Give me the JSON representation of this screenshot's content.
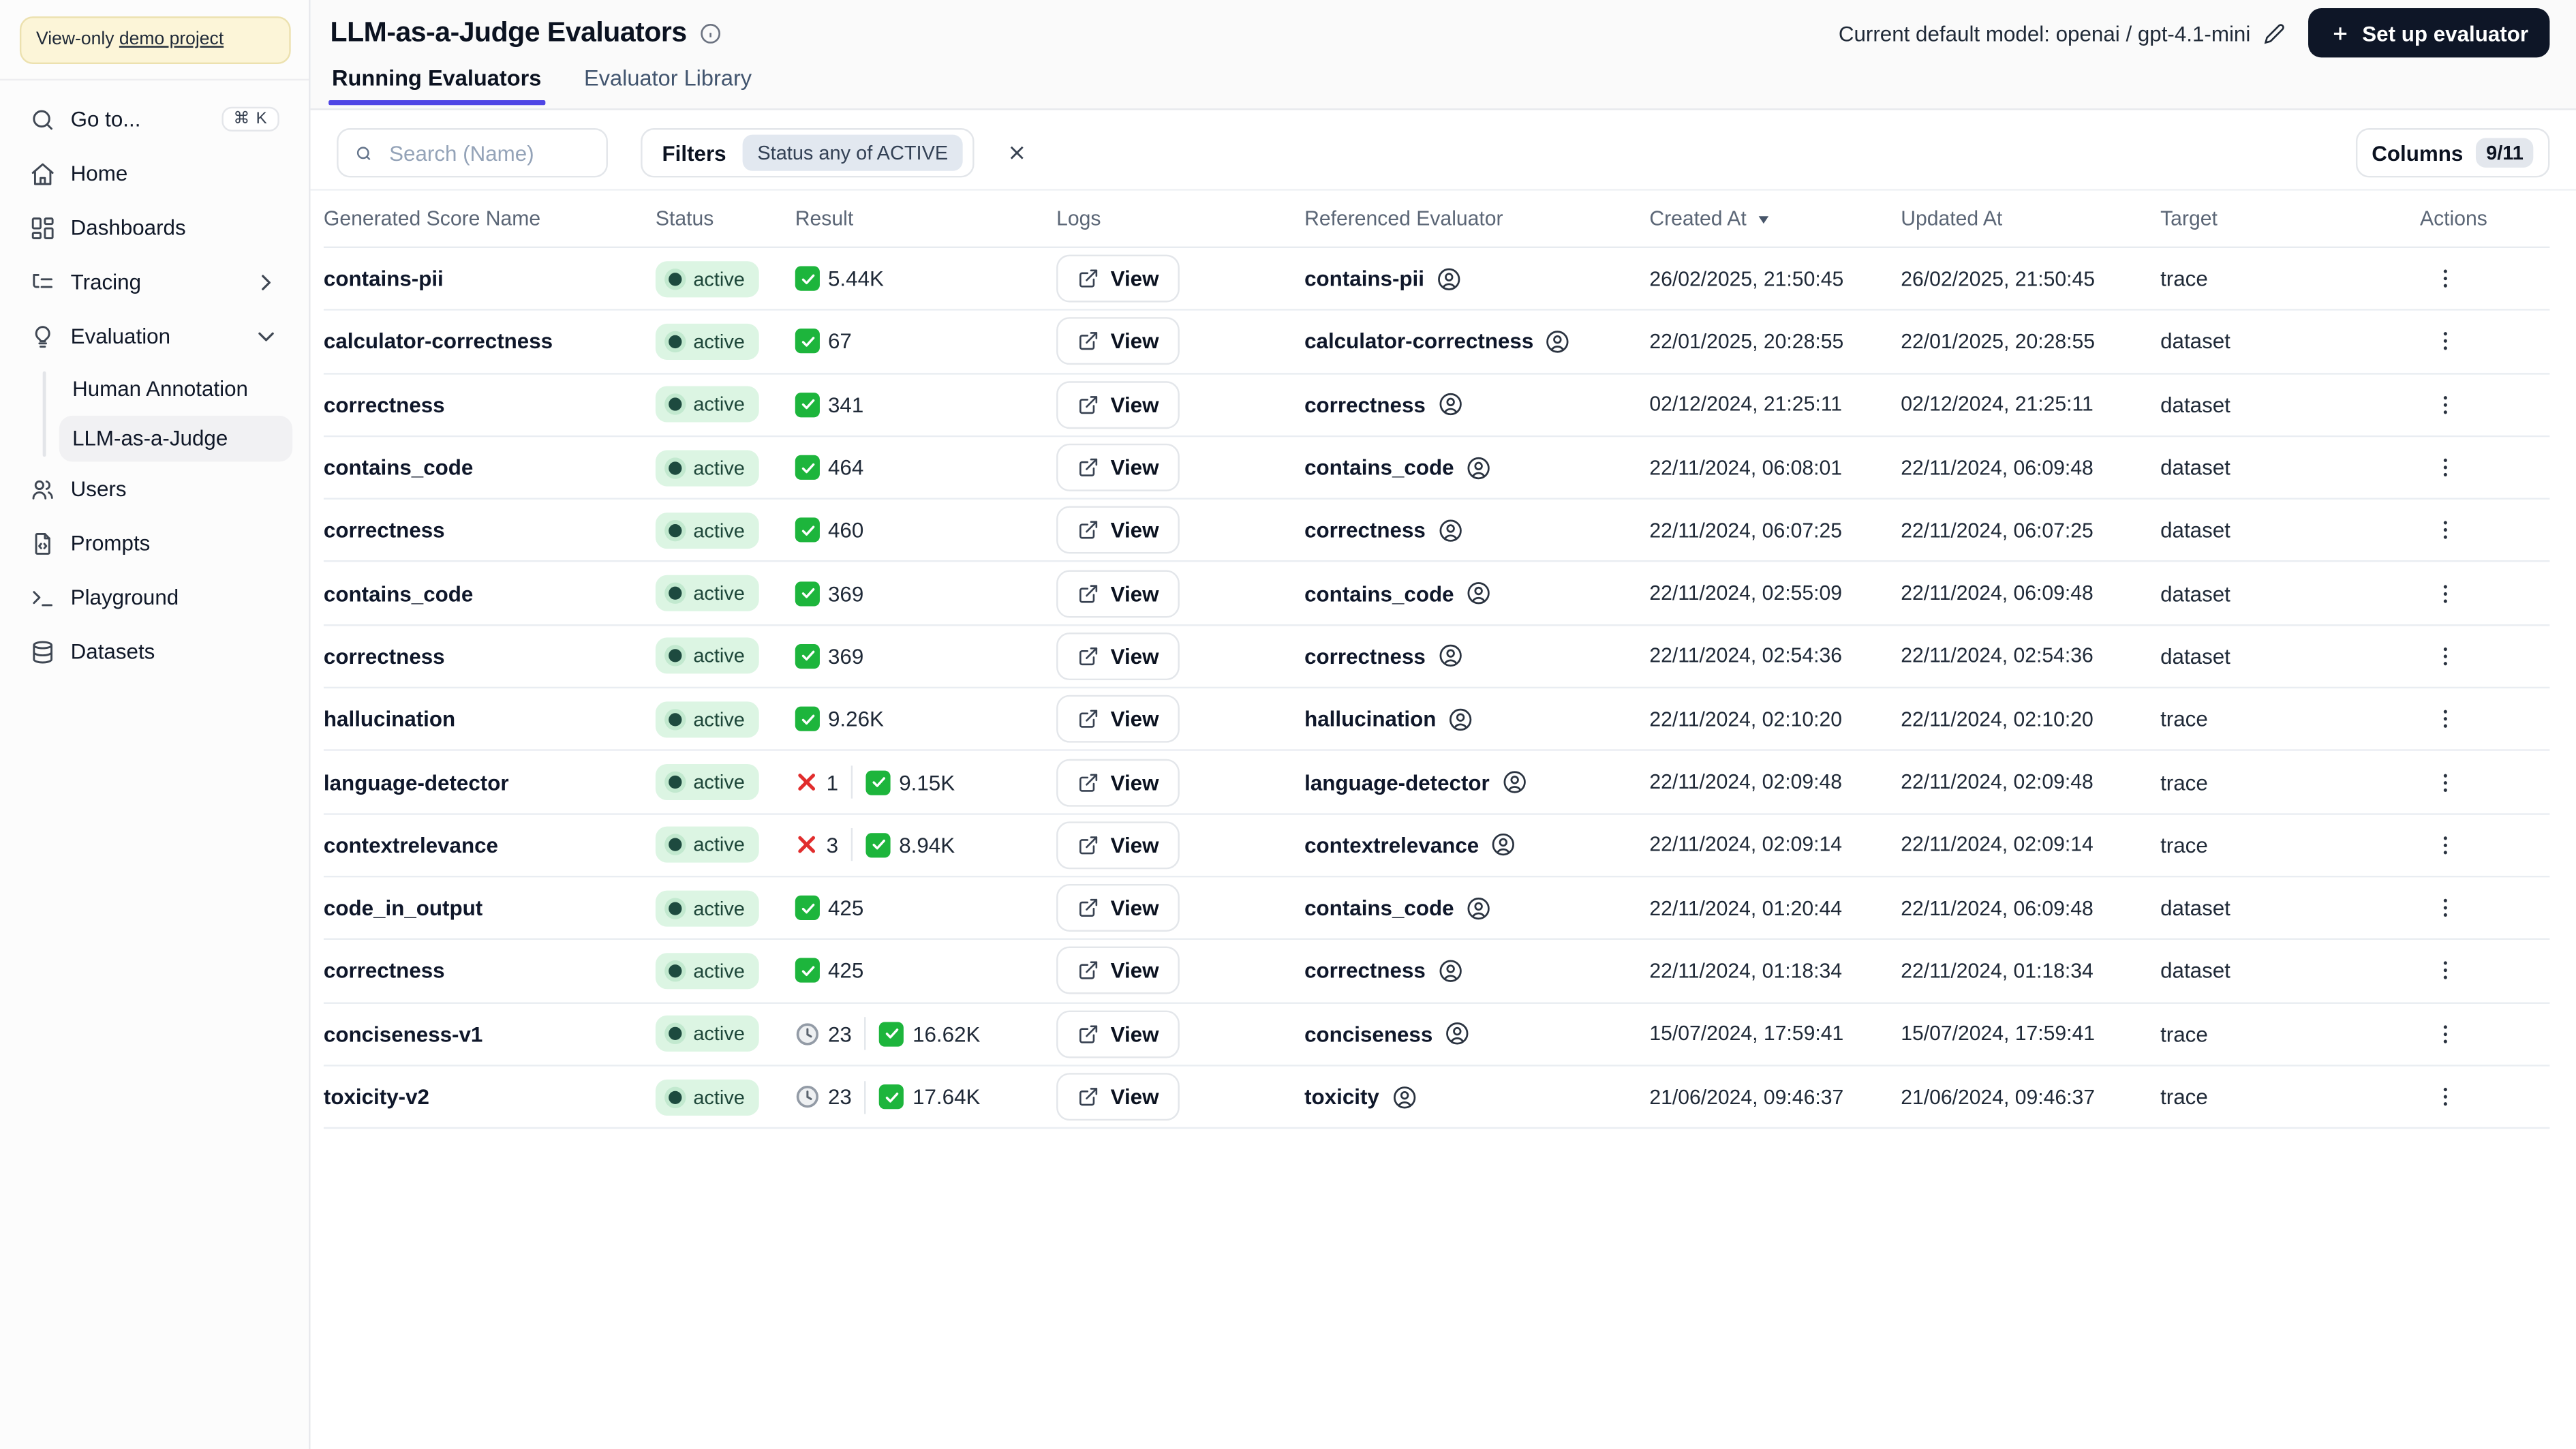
{
  "banner": {
    "prefix": "View-only ",
    "link": "demo project"
  },
  "sidebar": {
    "items": [
      {
        "id": "goto",
        "label": "Go to...",
        "icon": "search",
        "shortcut": "⌘ K"
      },
      {
        "id": "home",
        "label": "Home",
        "icon": "home"
      },
      {
        "id": "dashboards",
        "label": "Dashboards",
        "icon": "dashboard"
      },
      {
        "id": "tracing",
        "label": "Tracing",
        "icon": "tracing",
        "chevron": "right"
      },
      {
        "id": "evaluation",
        "label": "Evaluation",
        "icon": "lightbulb",
        "chevron": "down"
      },
      {
        "id": "human-annotation",
        "label": "Human Annotation",
        "sub": true
      },
      {
        "id": "llm-as-a-judge",
        "label": "LLM-as-a-Judge",
        "sub": true,
        "active": true
      },
      {
        "id": "users",
        "label": "Users",
        "icon": "users"
      },
      {
        "id": "prompts",
        "label": "Prompts",
        "icon": "prompts"
      },
      {
        "id": "playground",
        "label": "Playground",
        "icon": "playground"
      },
      {
        "id": "datasets",
        "label": "Datasets",
        "icon": "datasets"
      }
    ]
  },
  "header": {
    "title": "LLM-as-a-Judge Evaluators",
    "model_label": "Current default model: openai / gpt-4.1-mini",
    "setup_label": "Set up evaluator"
  },
  "tabs": [
    {
      "label": "Running Evaluators",
      "active": true
    },
    {
      "label": "Evaluator Library",
      "active": false
    }
  ],
  "toolbar": {
    "search_placeholder": "Search (Name)",
    "filters_label": "Filters",
    "filter_chip": "Status any of ACTIVE",
    "columns_label": "Columns",
    "columns_badge": "9/11"
  },
  "table": {
    "columns": [
      {
        "label": "Generated Score Name"
      },
      {
        "label": "Status"
      },
      {
        "label": "Result"
      },
      {
        "label": "Logs"
      },
      {
        "label": "Referenced Evaluator"
      },
      {
        "label": "Created At",
        "sort": "desc"
      },
      {
        "label": "Updated At"
      },
      {
        "label": "Target"
      },
      {
        "label": "Actions"
      }
    ],
    "view_label": "View",
    "status_label": "active",
    "rows": [
      {
        "name": "contains-pii",
        "status": "active",
        "result": [
          {
            "icon": "check-icon",
            "count": "5.44K"
          }
        ],
        "referenced": "contains-pii",
        "created_at": "26/02/2025, 21:50:45",
        "updated_at": "26/02/2025, 21:50:45",
        "target": "trace"
      },
      {
        "name": "calculator-correctness",
        "status": "active",
        "result": [
          {
            "icon": "check-icon",
            "count": "67"
          }
        ],
        "referenced": "calculator-correctness",
        "created_at": "22/01/2025, 20:28:55",
        "updated_at": "22/01/2025, 20:28:55",
        "target": "dataset"
      },
      {
        "name": "correctness",
        "status": "active",
        "result": [
          {
            "icon": "check-icon",
            "count": "341"
          }
        ],
        "referenced": "correctness",
        "created_at": "02/12/2024, 21:25:11",
        "updated_at": "02/12/2024, 21:25:11",
        "target": "dataset"
      },
      {
        "name": "contains_code",
        "status": "active",
        "result": [
          {
            "icon": "check-icon",
            "count": "464"
          }
        ],
        "referenced": "contains_code",
        "created_at": "22/11/2024, 06:08:01",
        "updated_at": "22/11/2024, 06:09:48",
        "target": "dataset"
      },
      {
        "name": "correctness",
        "status": "active",
        "result": [
          {
            "icon": "check-icon",
            "count": "460"
          }
        ],
        "referenced": "correctness",
        "created_at": "22/11/2024, 06:07:25",
        "updated_at": "22/11/2024, 06:07:25",
        "target": "dataset"
      },
      {
        "name": "contains_code",
        "status": "active",
        "result": [
          {
            "icon": "check-icon",
            "count": "369"
          }
        ],
        "referenced": "contains_code",
        "created_at": "22/11/2024, 02:55:09",
        "updated_at": "22/11/2024, 06:09:48",
        "target": "dataset"
      },
      {
        "name": "correctness",
        "status": "active",
        "result": [
          {
            "icon": "check-icon",
            "count": "369"
          }
        ],
        "referenced": "correctness",
        "created_at": "22/11/2024, 02:54:36",
        "updated_at": "22/11/2024, 02:54:36",
        "target": "dataset"
      },
      {
        "name": "hallucination",
        "status": "active",
        "result": [
          {
            "icon": "check-icon",
            "count": "9.26K"
          }
        ],
        "referenced": "hallucination",
        "created_at": "22/11/2024, 02:10:20",
        "updated_at": "22/11/2024, 02:10:20",
        "target": "trace"
      },
      {
        "name": "language-detector",
        "status": "active",
        "result": [
          {
            "icon": "cross-icon",
            "count": "1"
          },
          {
            "icon": "check-icon",
            "count": "9.15K"
          }
        ],
        "referenced": "language-detector",
        "created_at": "22/11/2024, 02:09:48",
        "updated_at": "22/11/2024, 02:09:48",
        "target": "trace"
      },
      {
        "name": "contextrelevance",
        "status": "active",
        "result": [
          {
            "icon": "cross-icon",
            "count": "3"
          },
          {
            "icon": "check-icon",
            "count": "8.94K"
          }
        ],
        "referenced": "contextrelevance",
        "created_at": "22/11/2024, 02:09:14",
        "updated_at": "22/11/2024, 02:09:14",
        "target": "trace"
      },
      {
        "name": "code_in_output",
        "status": "active",
        "result": [
          {
            "icon": "check-icon",
            "count": "425"
          }
        ],
        "referenced": "contains_code",
        "created_at": "22/11/2024, 01:20:44",
        "updated_at": "22/11/2024, 06:09:48",
        "target": "dataset"
      },
      {
        "name": "correctness",
        "status": "active",
        "result": [
          {
            "icon": "check-icon",
            "count": "425"
          }
        ],
        "referenced": "correctness",
        "created_at": "22/11/2024, 01:18:34",
        "updated_at": "22/11/2024, 01:18:34",
        "target": "dataset"
      },
      {
        "name": "conciseness-v1",
        "status": "active",
        "result": [
          {
            "icon": "clock-icon",
            "count": "23"
          },
          {
            "icon": "check-icon",
            "count": "16.62K"
          }
        ],
        "referenced": "conciseness",
        "created_at": "15/07/2024, 17:59:41",
        "updated_at": "15/07/2024, 17:59:41",
        "target": "trace"
      },
      {
        "name": "toxicity-v2",
        "status": "active",
        "result": [
          {
            "icon": "clock-icon",
            "count": "23"
          },
          {
            "icon": "check-icon",
            "count": "17.64K"
          }
        ],
        "referenced": "toxicity",
        "created_at": "21/06/2024, 09:46:37",
        "updated_at": "21/06/2024, 09:46:37",
        "target": "trace"
      }
    ]
  }
}
